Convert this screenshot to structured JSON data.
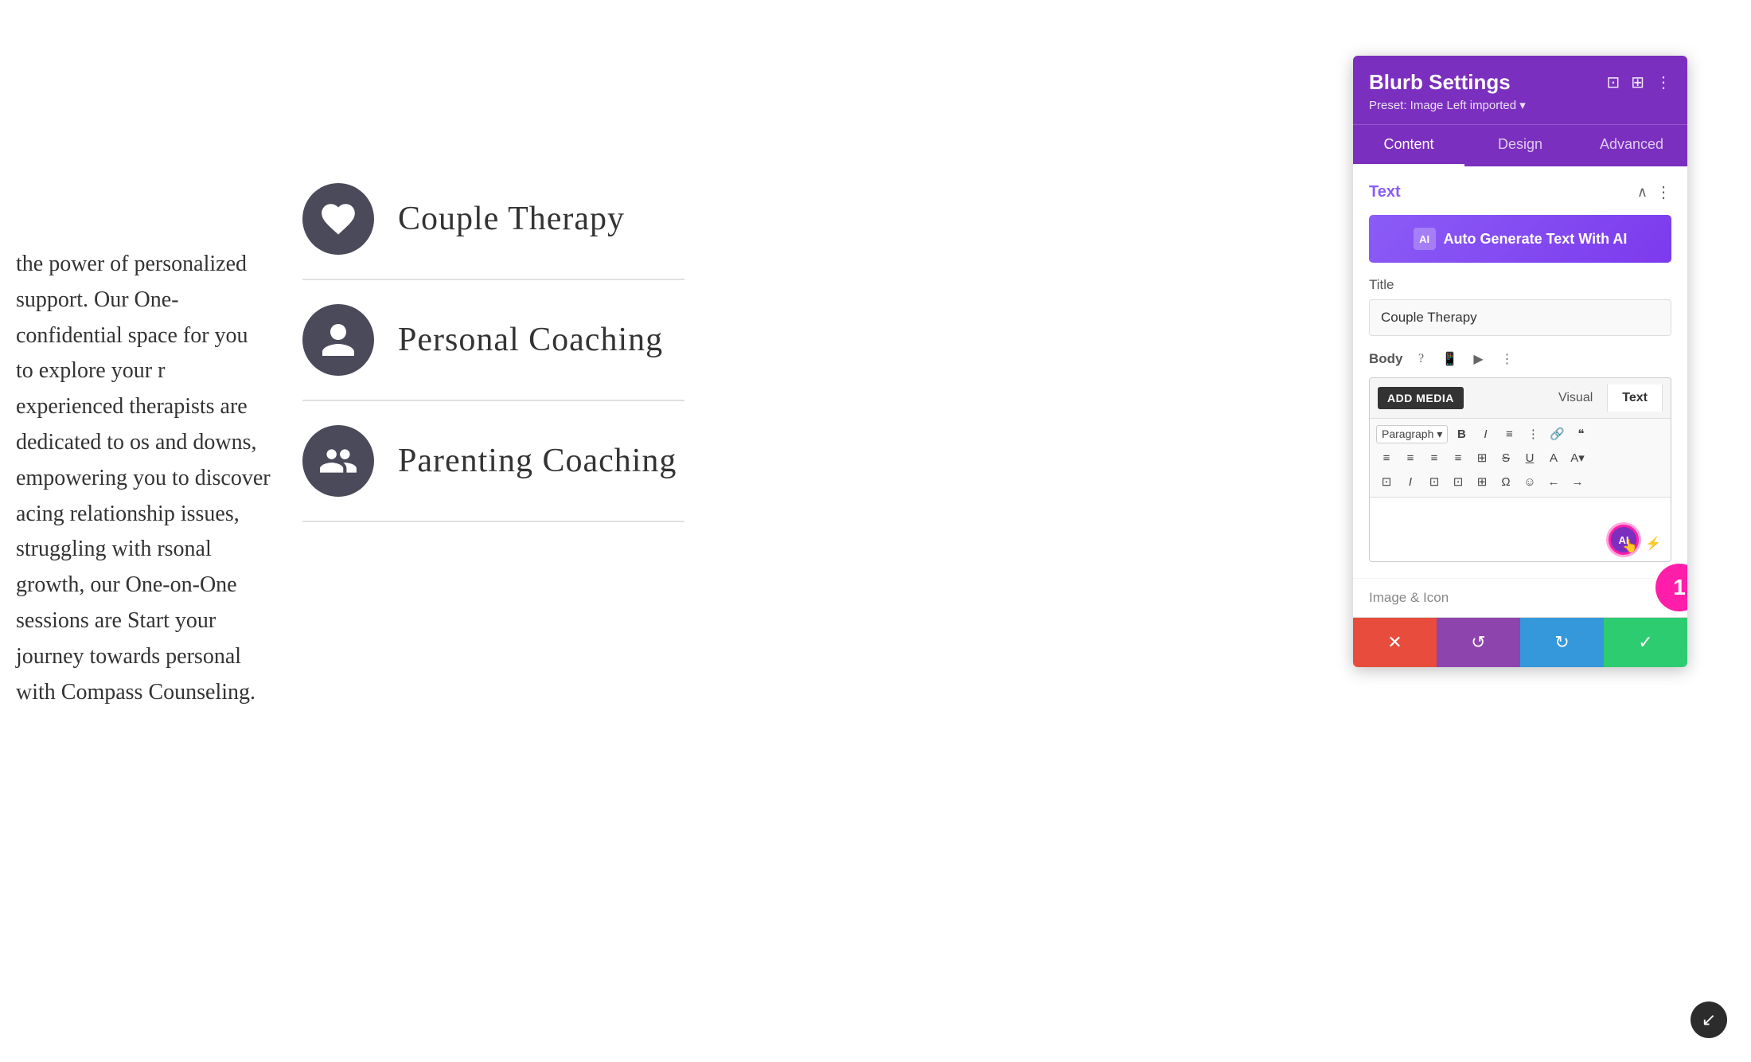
{
  "page": {
    "background_color": "#ffffff"
  },
  "left_text": {
    "content": "the power of personalized support. Our One-confidential space for you to explore your r experienced therapists are dedicated to os and downs, empowering you to discover acing relationship issues, struggling with rsonal growth, our One-on-One sessions are Start your journey towards personal with Compass Counseling."
  },
  "services": [
    {
      "label": "Couple Therapy",
      "icon": "heart"
    },
    {
      "label": "Personal Coaching",
      "icon": "person"
    },
    {
      "label": "Parenting Coaching",
      "icon": "group"
    }
  ],
  "panel": {
    "title": "Blurb Settings",
    "subtitle": "Preset: Image Left imported ▾",
    "tabs": [
      {
        "label": "Content",
        "active": true
      },
      {
        "label": "Design",
        "active": false
      },
      {
        "label": "Advanced",
        "active": false
      }
    ],
    "text_section": {
      "label": "Text",
      "ai_button_label": "Auto Generate Text With AI",
      "title_label": "Title",
      "title_value": "Couple Therapy",
      "body_label": "Body"
    },
    "editor": {
      "tabs": [
        {
          "label": "Visual",
          "active": false
        },
        {
          "label": "Text",
          "active": true
        }
      ],
      "add_media_label": "ADD MEDIA",
      "paragraph_select": "Paragraph",
      "toolbar_buttons": [
        "B",
        "I",
        "≡",
        "≡",
        "🔗",
        "❝",
        "≡",
        "≡",
        "≡",
        "≡",
        "⊞",
        "S",
        "U",
        "A",
        "⊡",
        "I",
        "⊡",
        "⊡",
        "⊡",
        "Ω",
        "☺",
        "←",
        "→"
      ]
    },
    "image_section_label": "Image & Icon",
    "actions": {
      "cancel": "✕",
      "undo": "↺",
      "redo": "↻",
      "confirm": "✓"
    },
    "badge_number": "1"
  }
}
